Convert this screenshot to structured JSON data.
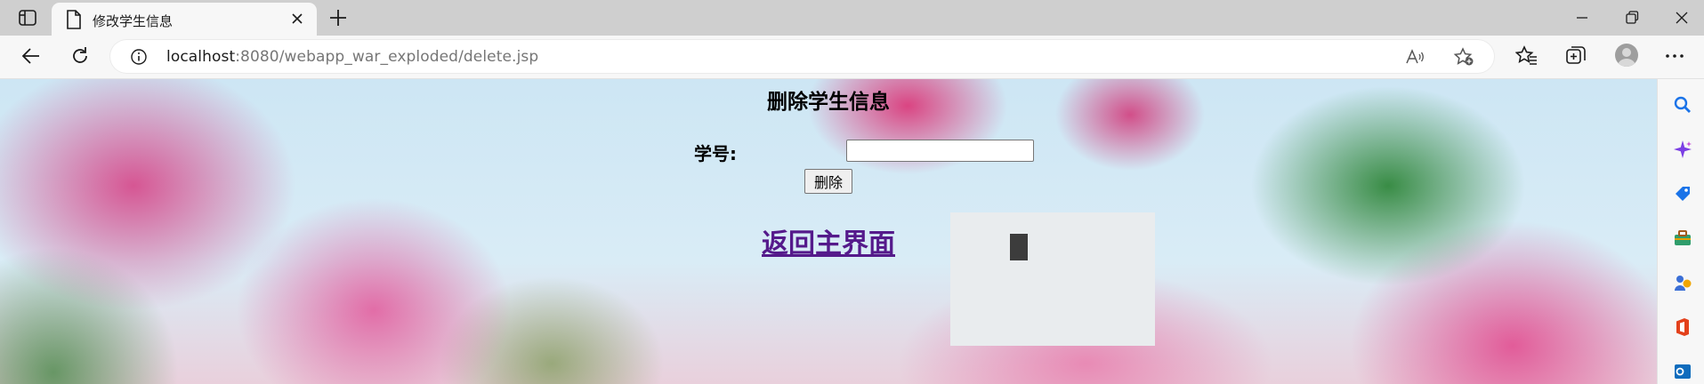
{
  "browser": {
    "tab": {
      "title": "修改学生信息"
    },
    "address": {
      "host": "localhost",
      "rest": ":8080/webapp_war_exploded/delete.jsp"
    }
  },
  "page": {
    "heading": "删除学生信息",
    "form": {
      "id_label": "学号:",
      "id_value": "",
      "delete_label": "删除"
    },
    "back_link": "返回主界面"
  },
  "sidebar": {
    "items": [
      "search-icon",
      "copilot-icon",
      "shopping-tag-icon",
      "tools-icon",
      "games-icon",
      "office-icon",
      "outlook-icon"
    ]
  },
  "colors": {
    "tab_strip": "#cfcfcf",
    "toolbar": "#f7f7f7",
    "link_visited": "#551a8b",
    "rail_search": "#1a73e8"
  }
}
